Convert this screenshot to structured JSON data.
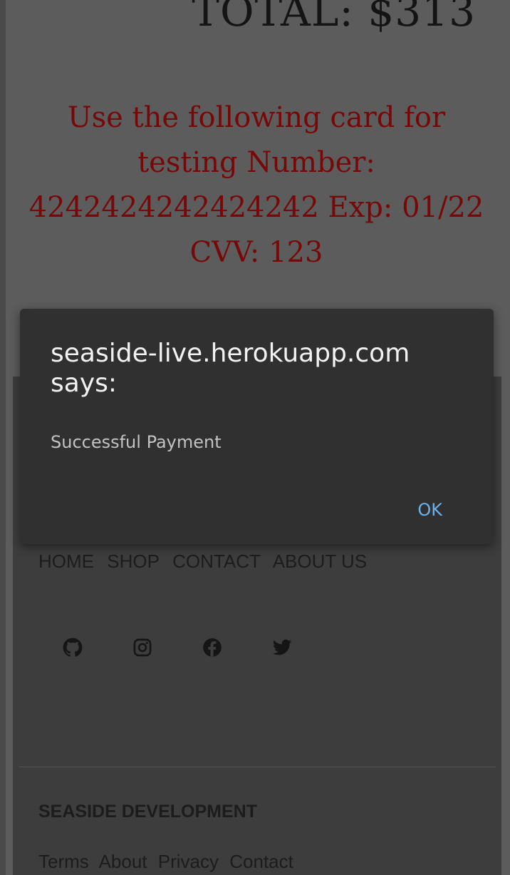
{
  "order": {
    "total": "TOTAL: $313"
  },
  "test_card": {
    "notice": "Use the following card for testing Number: 4242424242424242 Exp: 01/22 CVV: 123"
  },
  "footer": {
    "nav": [
      "HOME",
      "SHOP",
      "CONTACT",
      "ABOUT US"
    ],
    "social_icons": [
      "github-icon",
      "instagram-icon",
      "facebook-icon",
      "twitter-icon"
    ],
    "brand": "SEASIDE DEVELOPMENT",
    "legal_links": [
      "Terms",
      "About",
      "Privacy",
      "Contact"
    ]
  },
  "dialog": {
    "title": "seaside-live.herokuapp.com says:",
    "message": "Successful Payment",
    "ok_label": "OK"
  },
  "colors": {
    "accent": "#67b4f2",
    "notice": "#780808"
  }
}
